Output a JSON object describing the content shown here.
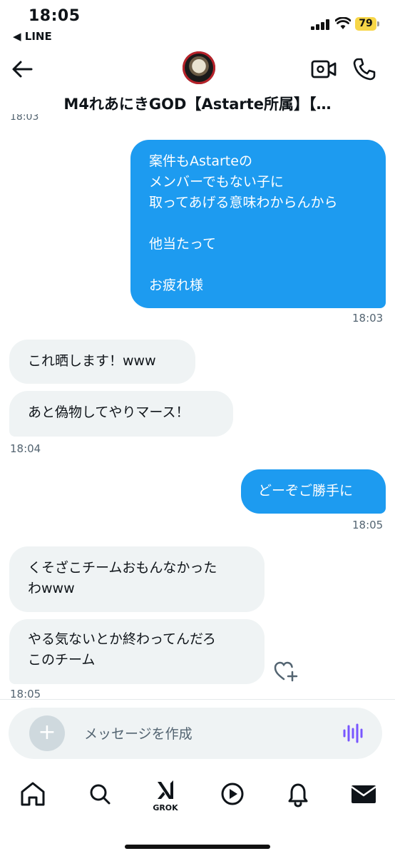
{
  "status_bar": {
    "time": "18:05",
    "back_app": "◀ LINE",
    "battery": "79"
  },
  "header": {
    "title": "M4れあにきGOD【Astarte所属】【…",
    "cut_timestamp": "18:03"
  },
  "messages": [
    {
      "side": "out",
      "text": "案件もAstarteの\nメンバーでもない子に\n取ってあげる意味わからんから\n\n他当たって\n\nお疲れ様",
      "time": "18:03"
    },
    {
      "side": "in",
      "text": "これ晒します！www"
    },
    {
      "side": "in",
      "text": "あと偽物してやりマース！",
      "time": "18:04"
    },
    {
      "side": "out",
      "text": "どーぞご勝手に",
      "time": "18:05"
    },
    {
      "side": "in",
      "text": "くそざこチームおもんなかった\nわwww"
    },
    {
      "side": "in",
      "text": "やる気ないとか終わってんだろ\nこのチーム",
      "time": "18:05"
    }
  ],
  "composer": {
    "placeholder": "メッセージを作成"
  },
  "tabbar": {
    "grok_label": "GROK"
  },
  "icons": [
    "back-arrow-icon",
    "video-call-icon",
    "phone-icon",
    "plus-icon",
    "voice-icon",
    "home-icon",
    "search-icon",
    "grok-icon",
    "play-icon",
    "bell-icon",
    "mail-icon",
    "heart-plus-icon"
  ],
  "colors": {
    "accent": "#1d9bf0",
    "incoming_bubble": "#eff3f4",
    "voice": "#7856ff"
  }
}
